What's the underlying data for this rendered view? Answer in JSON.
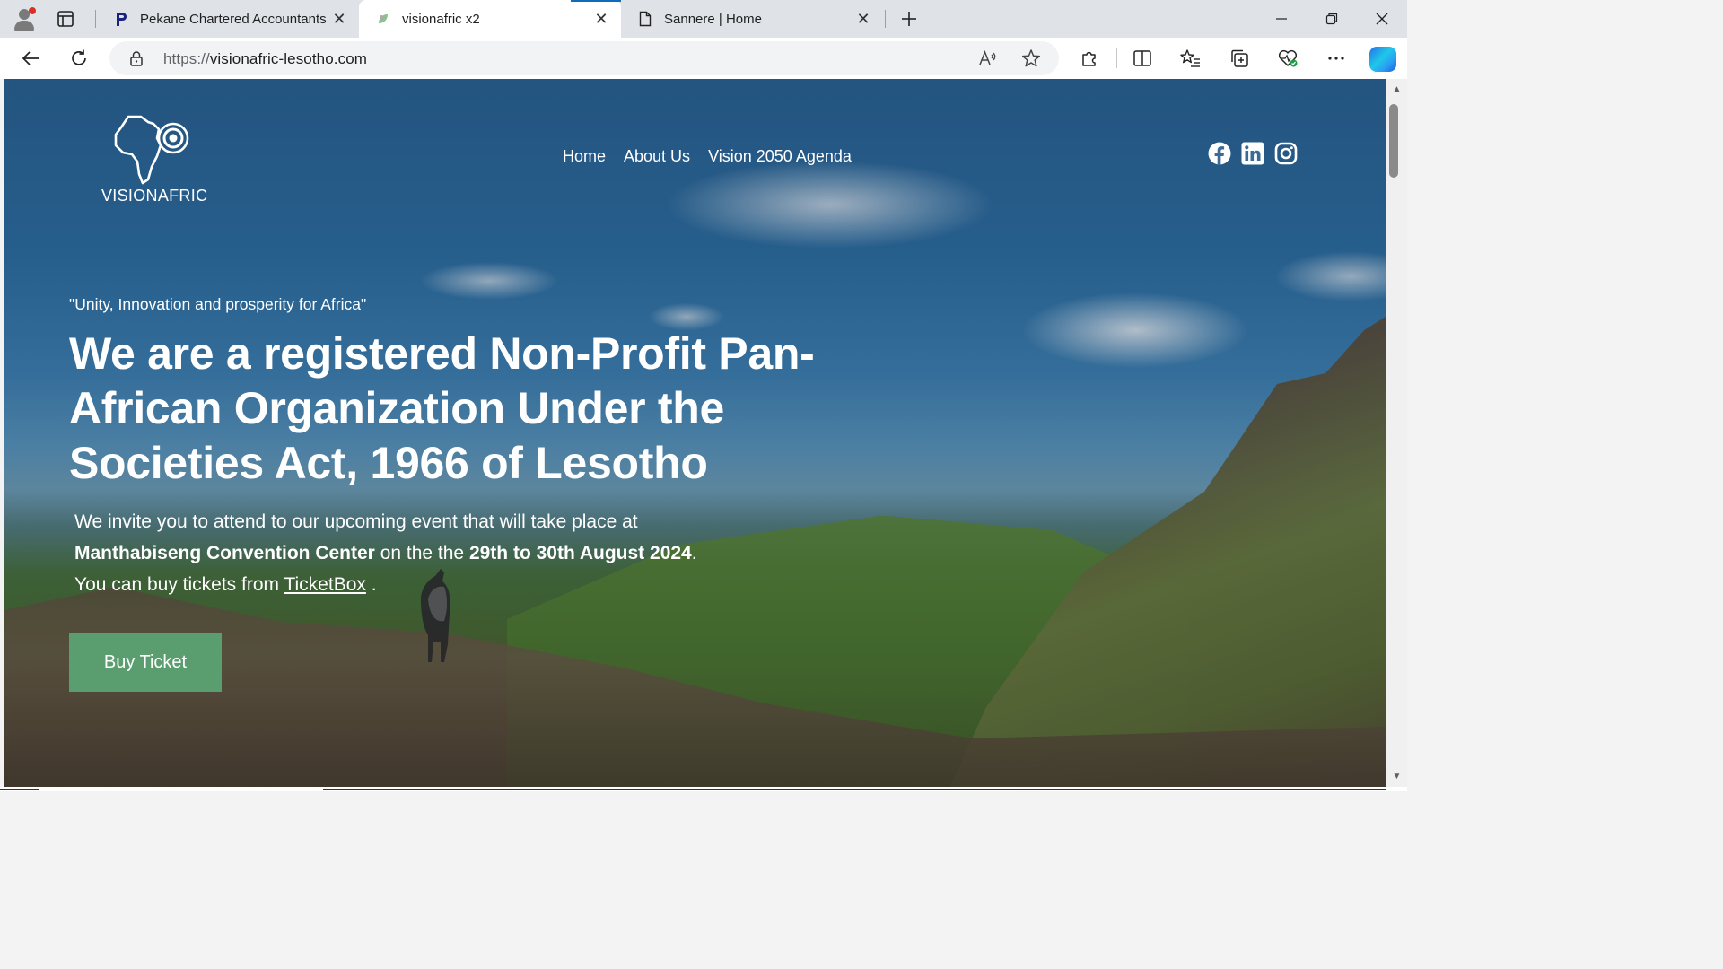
{
  "browser": {
    "tabs": [
      {
        "title": "Pekane Chartered Accountants",
        "favicon": "p-logo-icon"
      },
      {
        "title": "visionafric x2",
        "favicon": "leaf-icon"
      },
      {
        "title": "Sannere | Home",
        "favicon": "document-icon"
      }
    ],
    "active_tab": 1,
    "close_glyph": "✕",
    "address": {
      "scheme": "https://",
      "host": "visionafric-lesotho.com"
    },
    "icons": {
      "profile": "profile-avatar-icon",
      "tab_actions": "tab-actions-icon",
      "new_tab": "plus-icon",
      "minimize": "minimize-icon",
      "restore": "restore-icon",
      "close": "close-icon",
      "back": "back-arrow-icon",
      "reload": "reload-icon",
      "lock": "lock-icon",
      "read_aloud": "read-aloud-icon",
      "favorite": "star-icon",
      "extensions": "puzzle-icon",
      "split_screen": "split-screen-icon",
      "favorites": "favorites-list-icon",
      "collections": "collections-icon",
      "health": "browser-essentials-icon",
      "more": "more-dots-icon",
      "copilot": "copilot-icon"
    },
    "colors": {
      "tabstrip": "#dfe3e8",
      "toolbar": "#ffffff",
      "omnibox": "#f1f3f4"
    }
  },
  "site": {
    "logo_text": "VISIONAFRIC",
    "nav": [
      "Home",
      "About Us",
      "Vision 2050 Agenda"
    ],
    "social": [
      "facebook-icon",
      "linkedin-icon",
      "instagram-icon"
    ],
    "tagline": "\"Unity, Innovation and prosperity for Africa\"",
    "headline": "We are a registered Non-Profit Pan-African Organization Under the Societies Act, 1966 of Lesotho",
    "invite": {
      "line1": "We invite you to attend to our upcoming event that will take place at",
      "venue": "Manthabiseng Convention Center",
      "mid": " on the the ",
      "dates": "29th to 30th August 2024",
      "end": ".",
      "line3_prefix": "You can buy tickets from ",
      "link": "TicketBox",
      "line3_suffix": " ."
    },
    "cta": "Buy Ticket",
    "colors": {
      "cta": "#5a9e6f",
      "text": "#ffffff"
    }
  }
}
